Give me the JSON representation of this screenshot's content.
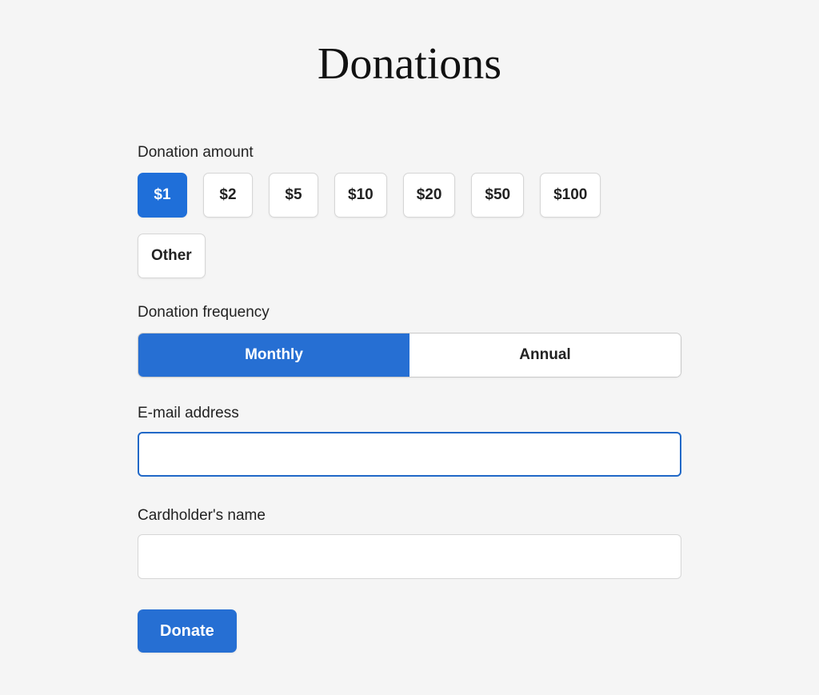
{
  "title": "Donations",
  "amount": {
    "label": "Donation amount",
    "options": [
      {
        "label": "$1",
        "selected": true
      },
      {
        "label": "$2",
        "selected": false
      },
      {
        "label": "$5",
        "selected": false
      },
      {
        "label": "$10",
        "selected": false
      },
      {
        "label": "$20",
        "selected": false
      },
      {
        "label": "$50",
        "selected": false
      },
      {
        "label": "$100",
        "selected": false
      },
      {
        "label": "Other",
        "selected": false
      }
    ]
  },
  "frequency": {
    "label": "Donation frequency",
    "options": [
      {
        "label": "Monthly",
        "selected": true
      },
      {
        "label": "Annual",
        "selected": false
      }
    ]
  },
  "email": {
    "label": "E-mail address",
    "value": "",
    "focused": true
  },
  "cardholder": {
    "label": "Cardholder's name",
    "value": "",
    "focused": false
  },
  "submit": {
    "label": "Donate"
  }
}
